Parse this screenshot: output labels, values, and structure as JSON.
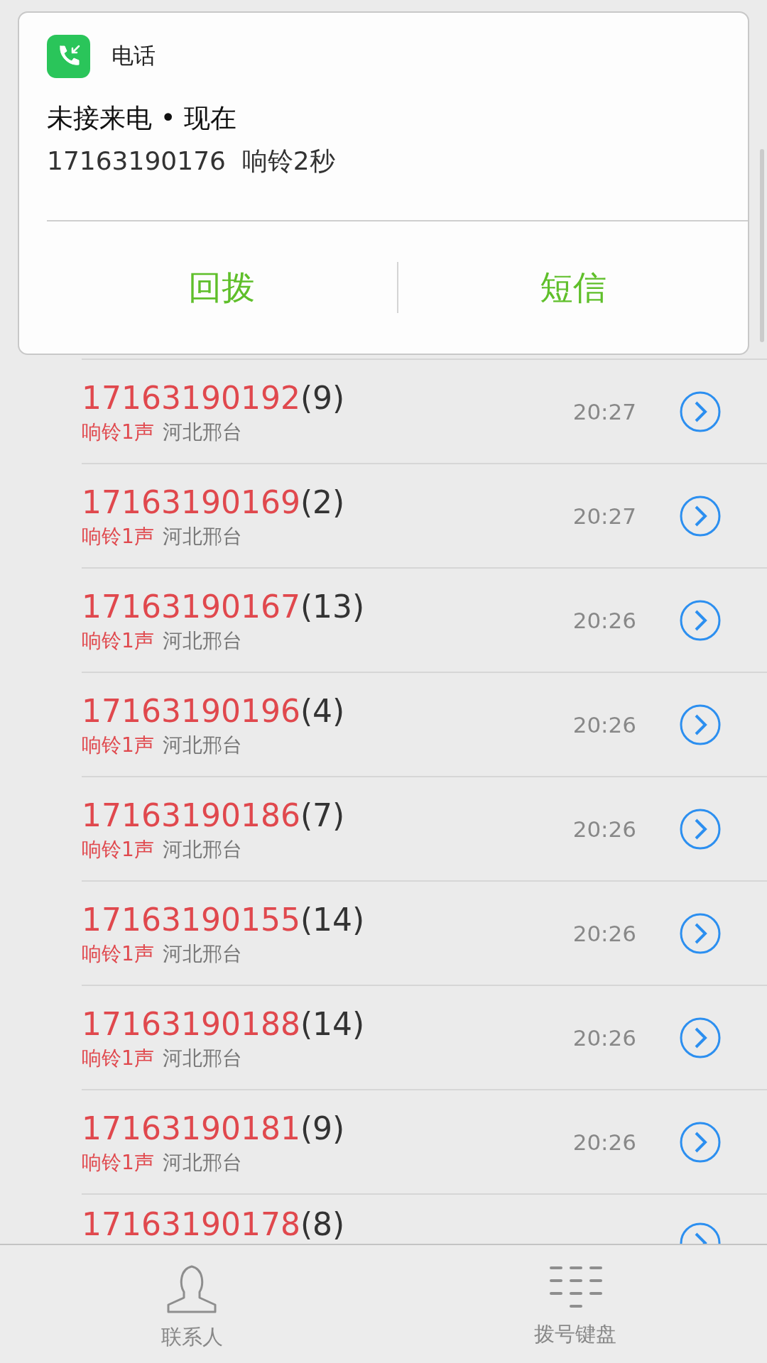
{
  "notification": {
    "app_name": "电话",
    "title": "未接来电 • 现在",
    "body": "17163190176  响铃2秒",
    "actions": [
      "回拨",
      "短信"
    ]
  },
  "calls": [
    {
      "number": "17163190192",
      "count": "(9)",
      "status": "响铃1声",
      "location": "河北邢台",
      "time": "20:27"
    },
    {
      "number": "17163190169",
      "count": "(2)",
      "status": "响铃1声",
      "location": "河北邢台",
      "time": "20:27"
    },
    {
      "number": "17163190167",
      "count": "(13)",
      "status": "响铃1声",
      "location": "河北邢台",
      "time": "20:26"
    },
    {
      "number": "17163190196",
      "count": "(4)",
      "status": "响铃1声",
      "location": "河北邢台",
      "time": "20:26"
    },
    {
      "number": "17163190186",
      "count": "(7)",
      "status": "响铃1声",
      "location": "河北邢台",
      "time": "20:26"
    },
    {
      "number": "17163190155",
      "count": "(14)",
      "status": "响铃1声",
      "location": "河北邢台",
      "time": "20:26"
    },
    {
      "number": "17163190188",
      "count": "(14)",
      "status": "响铃1声",
      "location": "河北邢台",
      "time": "20:26"
    },
    {
      "number": "17163190181",
      "count": "(9)",
      "status": "响铃1声",
      "location": "河北邢台",
      "time": "20:26"
    },
    {
      "number": "17163190178",
      "count": "(8)",
      "partial": true
    }
  ],
  "tab_bar": [
    {
      "kind": "contacts",
      "label": "联系人"
    },
    {
      "kind": "keypad",
      "label": "拨号键盘"
    }
  ]
}
